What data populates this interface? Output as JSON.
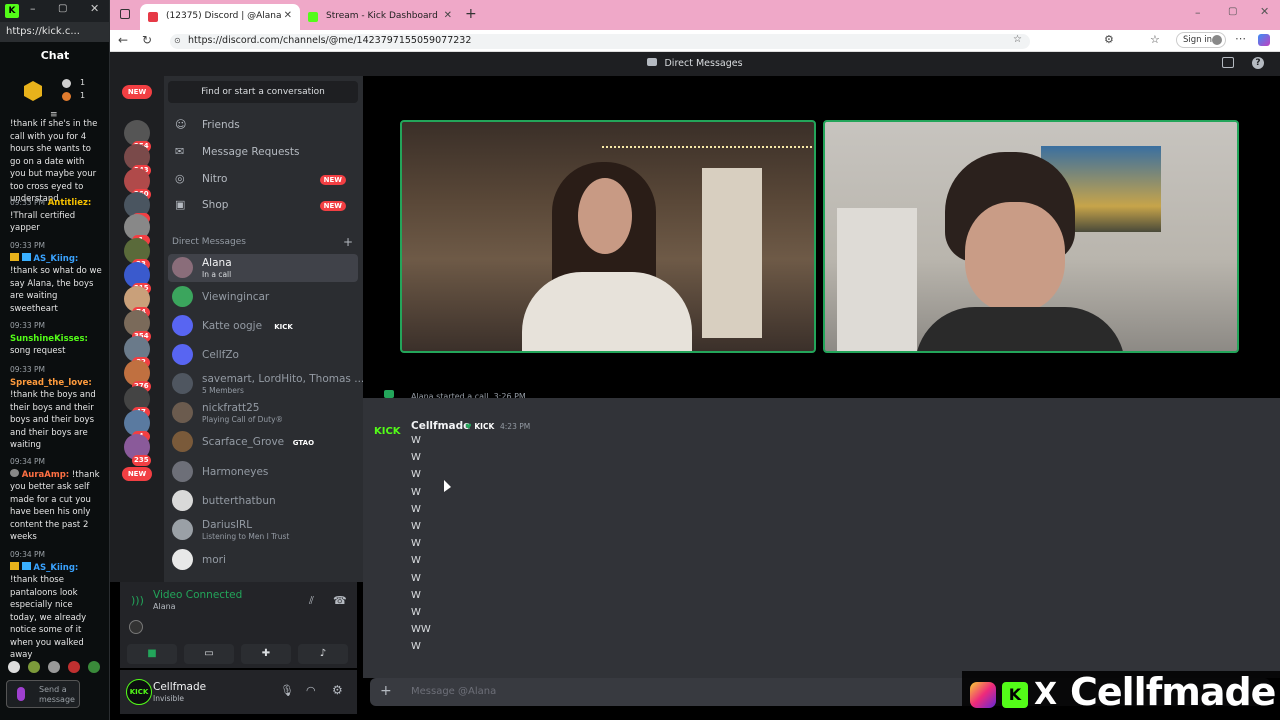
{
  "kick_window": {
    "url": "https://kick.c...",
    "chat_title": "Chat",
    "badge_counts": [
      "1",
      "1"
    ],
    "messages": [
      {
        "text": "!thank if she's in the call with you for 4 hours she wants to go on a date with you but maybe your too cross eyed to understand"
      },
      {
        "time": "09:33 PM",
        "user": "Antitliez:",
        "user_color": "#f5c000",
        "text": "!Thrall certified yapper"
      },
      {
        "time": "09:33 PM",
        "user": "AS_Kiing:",
        "user_color": "#3aa3ff",
        "text": "!thank so what do we say Alana, the boys are waiting sweetheart"
      },
      {
        "time": "09:33 PM",
        "user": "SunshineKisses:",
        "user_color": "#53fc18",
        "text": "song request"
      },
      {
        "time": "09:33 PM",
        "user": "Spread_the_love:",
        "user_color": "#ff9b3d",
        "text": "!thank the boys and their boys and their boys and their boys and their boys are waiting"
      },
      {
        "time": "09:34 PM",
        "user": "AuraAmp:",
        "user_color": "#ff7043",
        "text": "!thank you better ask self made for a cut you have been his only content the past 2 weeks"
      },
      {
        "time": "09:34 PM",
        "user": "AS_Kiing:",
        "user_color": "#3aa3ff",
        "text": "!thank those pantaloons look especially nice today, we already notice some of it when you walked away"
      }
    ],
    "send_placeholder": "Send a message"
  },
  "browser": {
    "tabs": [
      {
        "label": "(12375) Discord | @Alana"
      },
      {
        "label": "Stream - Kick Dashboard"
      }
    ],
    "url": "https://discord.com/channels/@me/1423797155059077232",
    "sign_in": "Sign in"
  },
  "discord": {
    "top_title": "Direct Messages",
    "guild_badges": [
      "NEW",
      "254",
      "343",
      "260",
      "1",
      "1",
      "23",
      "215",
      "74",
      "354",
      "82",
      "276",
      "47",
      "4",
      "235",
      "NEW"
    ],
    "find_placeholder": "Find or start a conversation",
    "nav": [
      {
        "label": "Friends",
        "tag": ""
      },
      {
        "label": "Message Requests",
        "tag": ""
      },
      {
        "label": "Nitro",
        "tag": "NEW"
      },
      {
        "label": "Shop",
        "tag": "NEW"
      }
    ],
    "dm_header": "Direct Messages",
    "dm_add": "+",
    "dms": [
      {
        "name": "Alana",
        "sub": "In a call",
        "tag": "",
        "color": "#8a6d7a"
      },
      {
        "name": "Viewingincar",
        "sub": "",
        "tag": "",
        "color": "#3ba55d"
      },
      {
        "name": "Katte oogje",
        "sub": "",
        "tag": "KICK",
        "color": "#5865f2"
      },
      {
        "name": "CellfZo",
        "sub": "",
        "tag": "",
        "color": "#5865f2"
      },
      {
        "name": "savemart, LordHito, Thomas ...",
        "sub": "5 Members",
        "tag": "",
        "color": "#4f5660"
      },
      {
        "name": "nickfratt25",
        "sub": "Playing Call of Duty®",
        "tag": "",
        "color": "#6b5b4e"
      },
      {
        "name": "Scarface_Grove",
        "sub": "",
        "tag": "GTAO",
        "color": "#7a5a3a"
      },
      {
        "name": "Harmoneyes",
        "sub": "",
        "tag": "",
        "color": "#6d6f78"
      },
      {
        "name": "butterthatbun",
        "sub": "",
        "tag": "",
        "color": "#d9d9d9"
      },
      {
        "name": "DariusIRL",
        "sub": "Listening to Men I Trust",
        "tag": "",
        "color": "#9aa0a6"
      },
      {
        "name": "mori",
        "sub": "",
        "tag": "",
        "color": "#e8e8e8"
      }
    ],
    "voice": {
      "status": "Video Connected",
      "channel": "Alana"
    },
    "user": {
      "name": "Cellfmade",
      "status": "Invisible"
    },
    "call_banner": "Alana started a call. 3:26 PM",
    "message": {
      "author": "Cellfmade",
      "badge": "KICK",
      "time": "4:23 PM",
      "lines": [
        "W",
        "W",
        "W",
        "W",
        "W",
        "W",
        "W",
        "W",
        "W",
        "W",
        "W",
        "WW",
        "W"
      ]
    },
    "input_placeholder": "Message @Alana"
  },
  "overlay": {
    "handle": "Cellfmade"
  }
}
